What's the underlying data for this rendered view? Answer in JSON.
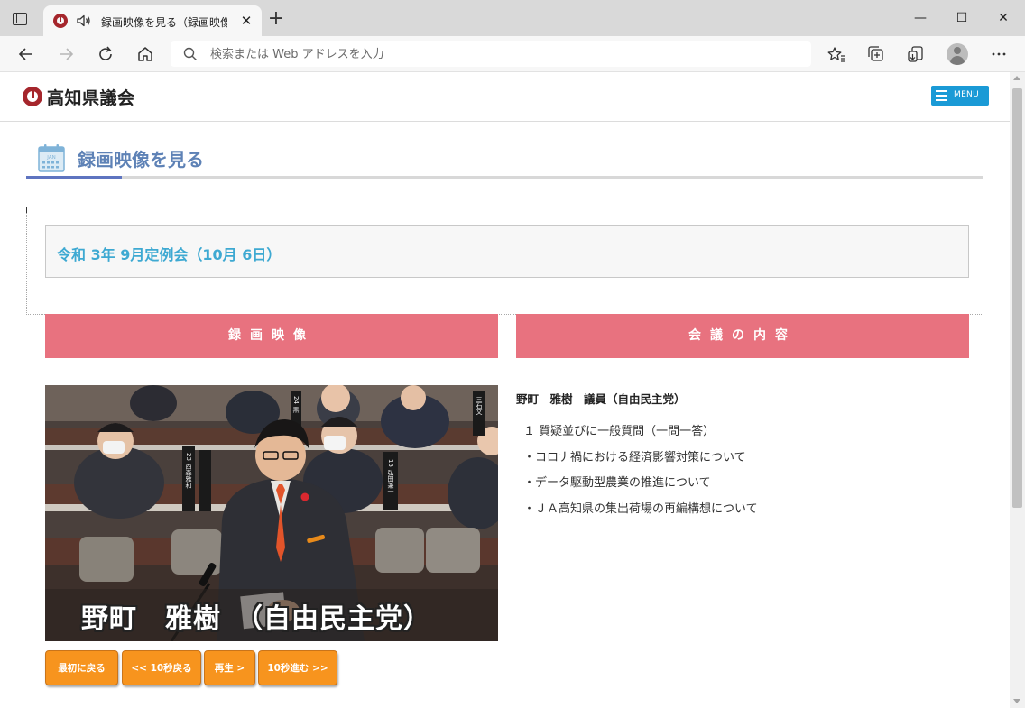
{
  "browser": {
    "tab_title": "録画映像を見る（録画映像）",
    "tab_close": "✕",
    "new_tab": "+",
    "address_placeholder": "検索または Web アドレスを入力",
    "window": {
      "minimize": "—",
      "maximize": "☐",
      "close": "✕"
    }
  },
  "site": {
    "logo_text": "高知県議会",
    "menu_label": "MENU"
  },
  "page": {
    "title": "録画映像を見る",
    "calendar_label": "JAN",
    "session_title": "令和 3年 9月定例会（10月 6日）",
    "sections": {
      "video": "録画映像",
      "content": "会議の内容"
    }
  },
  "video": {
    "caption": "野町　雅樹　（自由民主党）",
    "nameplates": [
      "23 西森雅和",
      "15 弘田兼一",
      "24 黒",
      "三石文"
    ],
    "controls": {
      "rewind_start": "最初に戻る",
      "back_10": "<< 10秒戻る",
      "play": "再生 >",
      "forward_10": "10秒進む >>"
    }
  },
  "meeting": {
    "member": "野町　雅樹　議員（自由民主党）",
    "items": [
      "１ 質疑並びに一般質問（一問一答）",
      "・コロナ禍における経済影響対策について",
      "・データ駆動型農業の推進について",
      "・ＪＡ高知県の集出荷場の再編構想について"
    ]
  },
  "colors": {
    "section_header": "#e8727f",
    "button_orange": "#f7941e",
    "title_blue": "#5e82b6",
    "session_blue": "#3ea9d2",
    "menu_blue": "#1a9ad6"
  }
}
